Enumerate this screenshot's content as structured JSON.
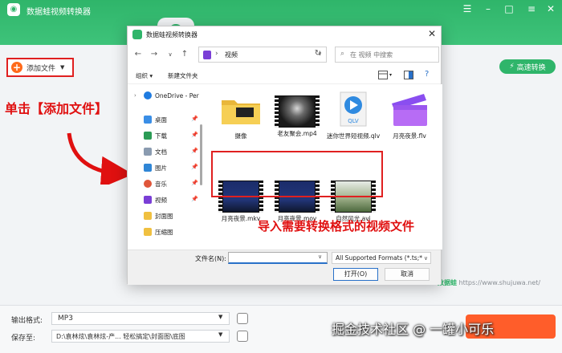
{
  "app": {
    "title": "数据蛙视频转换器",
    "add_file_label": "添加文件",
    "fast_convert_label": "高速转换",
    "output_format_label": "输出格式:",
    "output_format_value": "MP3",
    "save_to_label": "保存至:",
    "save_to_value": "D:\\袁林炫\\袁林炫-产... 轻松搞定\\封面图\\底图",
    "site_watermark_brand": "数据蛙",
    "site_watermark_url": "https://www.shujuwa.net/",
    "bottom_watermark": "掘金技术社区 @ 一罐小可乐",
    "accent_color": "#2fb56a"
  },
  "annotations": {
    "click_instruction": "单击【添加文件】",
    "import_instruction": "导入需要转换格式的视频文件"
  },
  "dialog": {
    "title": "数据蛙视频转换器",
    "address": "视频",
    "search_placeholder": "在 视频 中搜索",
    "organize_label": "组织 ▾",
    "new_folder_label": "新建文件夹",
    "filename_label": "文件名(N):",
    "filename_value": "",
    "file_type_filter": "All Supported Formats (*.ts;*",
    "open_button": "打开(O)",
    "cancel_button": "取消",
    "nav": [
      {
        "label": "OneDrive - Per",
        "icon": "cloud-icon"
      },
      {
        "label": "桌面",
        "icon": "desktop-icon"
      },
      {
        "label": "下载",
        "icon": "download-icon"
      },
      {
        "label": "文档",
        "icon": "document-icon"
      },
      {
        "label": "图片",
        "icon": "picture-icon"
      },
      {
        "label": "音乐",
        "icon": "music-icon"
      },
      {
        "label": "视频",
        "icon": "video-icon"
      },
      {
        "label": "封面图",
        "icon": "folder-icon"
      },
      {
        "label": "压缩图",
        "icon": "folder-icon"
      }
    ],
    "files": [
      {
        "name": "摄像",
        "kind": "folder"
      },
      {
        "name": "老友聚会.mp4",
        "kind": "video"
      },
      {
        "name": "迷你世界短视频.qlv",
        "kind": "qlv"
      },
      {
        "name": "月亮夜景.flv",
        "kind": "flv"
      },
      {
        "name": "月亮夜景.mkv",
        "kind": "video"
      },
      {
        "name": "月亮夜景.mov",
        "kind": "video"
      },
      {
        "name": "自然风光.avi",
        "kind": "video"
      }
    ]
  }
}
